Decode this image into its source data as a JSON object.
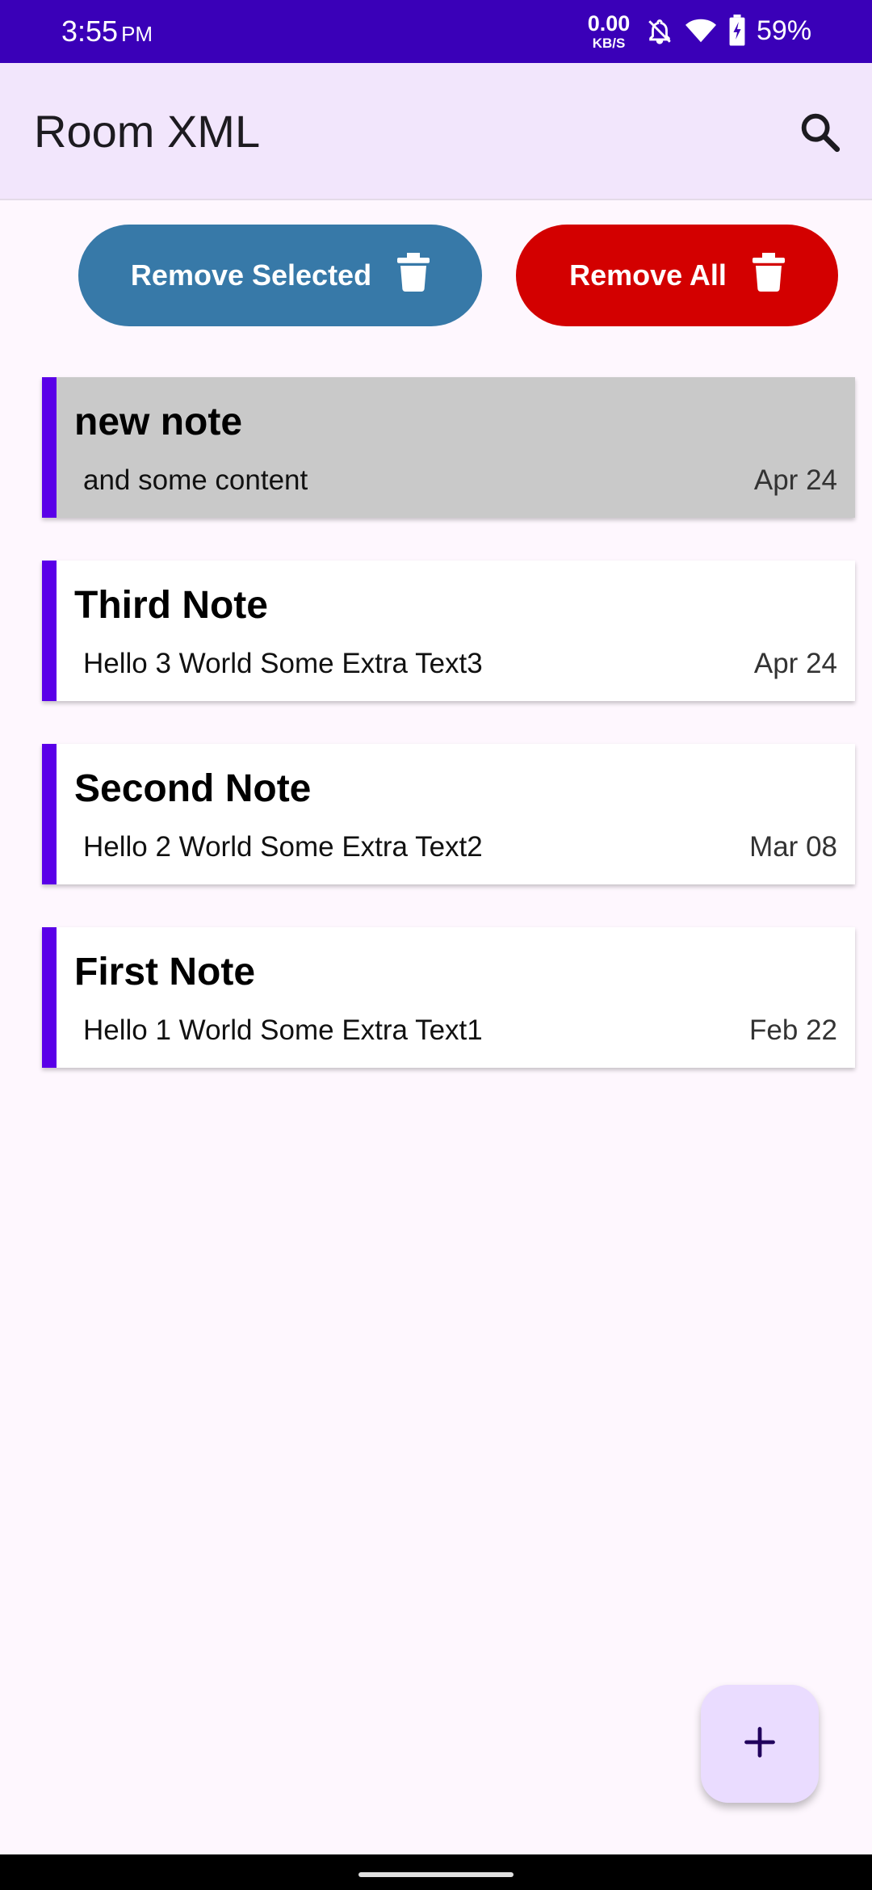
{
  "status_bar": {
    "time": "3:55",
    "ampm": "PM",
    "net_speed_value": "0.00",
    "net_speed_unit": "KB/S",
    "battery": "59%",
    "icons": [
      "bell-off-icon",
      "wifi-icon",
      "battery-charging-icon"
    ]
  },
  "app_bar": {
    "title": "Room XML",
    "search_icon": "search-icon"
  },
  "actions": {
    "remove_selected": "Remove Selected",
    "remove_all": "Remove All",
    "remove_selected_color": "#3779a8",
    "remove_all_color": "#d30000"
  },
  "notes": [
    {
      "title": "new note",
      "content": "and some content",
      "date": "Apr 24",
      "selected": true
    },
    {
      "title": "Third Note",
      "content": "Hello 3 World Some Extra Text3",
      "date": "Apr 24",
      "selected": false
    },
    {
      "title": "Second Note",
      "content": "Hello 2 World Some Extra Text2",
      "date": "Mar 08",
      "selected": false
    },
    {
      "title": "First Note",
      "content": "Hello 1 World Some Extra Text1",
      "date": "Feb 22",
      "selected": false
    }
  ],
  "fab": {
    "icon": "plus-icon"
  },
  "colors": {
    "status_bar": "#3a00b8",
    "app_bar": "#f2e6fc",
    "accent_stripe": "#5a00e8",
    "selected_note": "#c9c9c9",
    "fab": "#eadcff"
  }
}
